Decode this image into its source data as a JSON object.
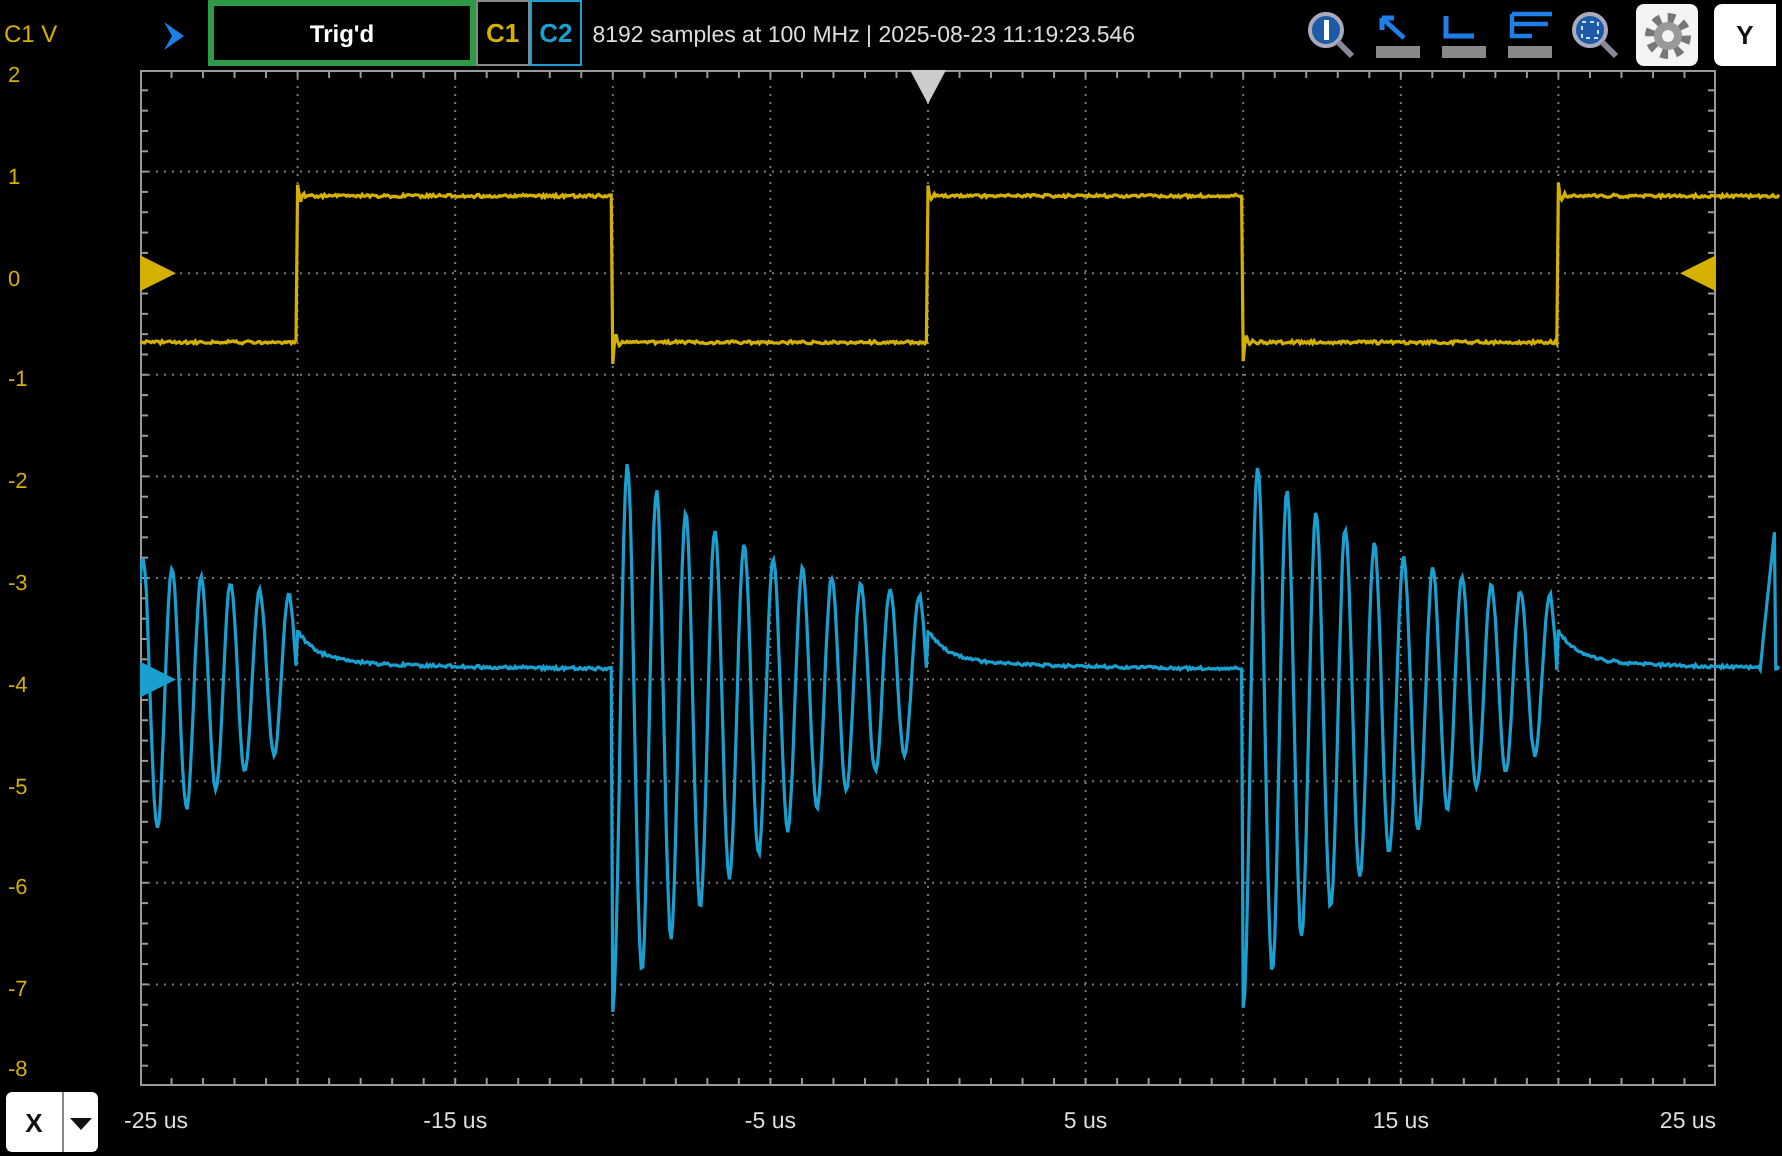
{
  "top_bar": {
    "units_label": "C1 V",
    "trigger_status": "Trig'd",
    "channels": [
      {
        "label": "C1",
        "color": "#d4b000",
        "selected": false,
        "kind": "square"
      },
      {
        "label": "C2",
        "color": "#1aa0d0",
        "selected": true,
        "kind": "ringing"
      }
    ],
    "acquisition_info": "8192 samples at 100 MHz | 2025-08-23 11:19:23.546",
    "y_button": "Y"
  },
  "y_axis": {
    "labels": [
      "2",
      "1",
      "0",
      "-1",
      "-2",
      "-3",
      "-4",
      "-5",
      "-6",
      "-7",
      "-8"
    ]
  },
  "x_axis": {
    "button": "X",
    "labels": [
      "-25 us",
      "-15 us",
      "-5 us",
      "5 us",
      "15 us",
      "25 us"
    ]
  }
}
